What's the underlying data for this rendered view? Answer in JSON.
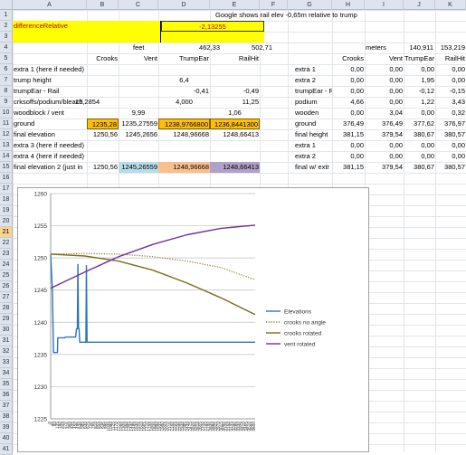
{
  "columns": [
    "A",
    "B",
    "C",
    "D",
    "E",
    "F",
    "G",
    "H",
    "I",
    "J",
    "K"
  ],
  "rows": [
    "1",
    "2",
    "3",
    "4",
    "5",
    "6",
    "7",
    "8",
    "9",
    "10",
    "11",
    "12",
    "13",
    "14",
    "15",
    "16",
    "17",
    "18",
    "19",
    "20",
    "21",
    "22",
    "23",
    "24",
    "25",
    "26",
    "27",
    "28",
    "29",
    "30",
    "31",
    "32",
    "33",
    "34",
    "35",
    "36",
    "37",
    "38",
    "39",
    "40",
    "41"
  ],
  "header_note": "Google shows rail elev -0,65m relative to trump",
  "row2": {
    "label": "differenceRelative",
    "value": "-2,13255"
  },
  "row4": {
    "feet_label": "feet",
    "feet_d": "462,33",
    "feet_e": "502,71",
    "meters_label": "meters",
    "meters_j": "140,911",
    "meters_k": "153,219"
  },
  "left_table": {
    "headers": [
      "Crooks",
      "Vent",
      "TrumpEar",
      "RailHit"
    ],
    "rows": [
      {
        "label": "extra 1 (here if needed)",
        "b": "",
        "c": "",
        "d": "",
        "e": ""
      },
      {
        "label": "trump height",
        "b": "",
        "c": "",
        "d": "6,4",
        "e": ""
      },
      {
        "label": "trumpEar - Rail",
        "b": "",
        "c": "",
        "d": "-0,41",
        "e": "-0,49"
      },
      {
        "label": "crksoffs/podium/bleach",
        "b": "15,2854",
        "c": "",
        "d": "4,000",
        "e": "11,25"
      },
      {
        "label": "woodblock / vent",
        "b": "",
        "c": "9,99",
        "d": "",
        "e": "1,06"
      },
      {
        "label": "ground",
        "b": "1235,28",
        "c": "1235,27559",
        "d": "1238,9766800",
        "e": "1236,8441300"
      },
      {
        "label": "final elevation",
        "b": "1250,56",
        "c": "1245,2656",
        "d": "1248,96668",
        "e": "1248,66413"
      },
      {
        "label": "extra 3  (here if needed)",
        "b": "",
        "c": "",
        "d": "",
        "e": ""
      },
      {
        "label": "extra 4 (here if needed)",
        "b": "",
        "c": "",
        "d": "",
        "e": ""
      },
      {
        "label": "final elevation 2 (just in",
        "b": "1250,56",
        "c": "1245,26559",
        "d": "1248,96668",
        "e": "1248,66413"
      }
    ]
  },
  "right_table": {
    "headers": [
      "Crooks",
      "Vent",
      "TrumpEar",
      "RailHit"
    ],
    "rows": [
      {
        "label": "extra 1",
        "h": "0,00",
        "i": "0,00",
        "j": "0,00",
        "k": "0,00"
      },
      {
        "label": "extra 2",
        "h": "0,00",
        "i": "0,00",
        "j": "1,95",
        "k": "0,00"
      },
      {
        "label": "trumpEar - R",
        "h": "0,00",
        "i": "0,00",
        "j": "-0,12",
        "k": "-0,15"
      },
      {
        "label": "podium",
        "h": "4,66",
        "i": "0,00",
        "j": "1,22",
        "k": "3,43"
      },
      {
        "label": "wooden",
        "h": "0,00",
        "i": "3,04",
        "j": "0,00",
        "k": "0,32"
      },
      {
        "label": "ground",
        "h": "376,49",
        "i": "376,49",
        "j": "377,62",
        "k": "376,97"
      },
      {
        "label": "final height",
        "h": "381,15",
        "i": "379,54",
        "j": "380,67",
        "k": "380,57"
      },
      {
        "label": "extra 1",
        "h": "0,00",
        "i": "0,00",
        "j": "0,00",
        "k": "0,00"
      },
      {
        "label": "extra 2",
        "h": "0,00",
        "i": "0,00",
        "j": "0,00",
        "k": "0,00"
      },
      {
        "label": "final w/ extr",
        "h": "381,15",
        "i": "379,54",
        "j": "380,67",
        "k": "380,57"
      }
    ]
  },
  "colors": {
    "yellow": "#ffff00",
    "ground_highlight": "#ffc000",
    "vent_fill": "#b7dee8",
    "trumpear_fill": "#fabf8f",
    "railhit_fill": "#b1a0c7",
    "elevations": "#2e75b6",
    "crooks_no_angle": "#8b7d2a",
    "crooks_rotated": "#7f6b1a",
    "vent_rotated": "#7030a0"
  },
  "chart_data": {
    "type": "line",
    "title": "",
    "xlabel": "",
    "ylabel": "",
    "ylim": [
      1225,
      1260
    ],
    "yticks": [
      1225,
      1230,
      1235,
      1240,
      1245,
      1250,
      1255,
      1260
    ],
    "x": [
      0,
      45,
      90,
      135,
      180,
      225,
      270,
      315,
      360,
      405,
      450,
      495,
      540,
      585,
      630,
      675,
      720,
      765,
      810,
      855,
      900,
      945,
      990,
      1035,
      1080,
      1125,
      1170,
      1215,
      1260,
      1305,
      1350,
      1395,
      1440,
      1485,
      1530,
      1575,
      1620,
      1665,
      1710,
      1755,
      1800,
      1845,
      1890,
      1935,
      1980,
      2025,
      2070,
      2115,
      2160,
      2205,
      2250,
      2295,
      2340,
      2385,
      2430,
      2475,
      2520,
      2565,
      2610,
      2655,
      2700,
      2745,
      2790,
      2835,
      2880,
      2925,
      2970,
      3015,
      3060,
      3105,
      3150,
      3195,
      3240,
      3285,
      3330,
      3375,
      3420,
      3465,
      3510,
      3555,
      3600
    ],
    "series": [
      {
        "name": "Elevations",
        "style": "solid",
        "color": "#2e75b6",
        "points": [
          [
            0,
            1250.5
          ],
          [
            30,
            1245
          ],
          [
            50,
            1235.3
          ],
          [
            90,
            1235.3
          ],
          [
            120,
            1235.3
          ],
          [
            125,
            1237.6
          ],
          [
            150,
            1237.6
          ],
          [
            250,
            1237.6
          ],
          [
            260,
            1237.7
          ],
          [
            440,
            1237.7
          ],
          [
            455,
            1239
          ],
          [
            470,
            1239
          ],
          [
            480,
            1249
          ],
          [
            490,
            1239
          ],
          [
            500,
            1239
          ],
          [
            512,
            1236.9
          ],
          [
            600,
            1236.9
          ],
          [
            620,
            1236.9
          ],
          [
            630,
            1248.8
          ],
          [
            640,
            1236.9
          ],
          [
            3600,
            1236.9
          ]
        ]
      },
      {
        "name": "crooks no angle",
        "style": "dotted",
        "color": "#8b7d2a",
        "points": [
          [
            0,
            1250.6
          ],
          [
            600,
            1250.7
          ],
          [
            1200,
            1250.6
          ],
          [
            1800,
            1250.2
          ],
          [
            2400,
            1249.5
          ],
          [
            3000,
            1248.5
          ],
          [
            3600,
            1246.6
          ]
        ]
      },
      {
        "name": "crooks rotated",
        "style": "solid",
        "color": "#7f6b1a",
        "points": [
          [
            0,
            1250.6
          ],
          [
            600,
            1250.3
          ],
          [
            1200,
            1249.5
          ],
          [
            1800,
            1248.1
          ],
          [
            2400,
            1246.1
          ],
          [
            3000,
            1243.8
          ],
          [
            3600,
            1241.2
          ]
        ]
      },
      {
        "name": "vent rotated",
        "style": "solid",
        "color": "#7030a0",
        "points": [
          [
            0,
            1245.3
          ],
          [
            600,
            1247.8
          ],
          [
            1200,
            1250.2
          ],
          [
            1800,
            1252.1
          ],
          [
            2400,
            1253.6
          ],
          [
            3000,
            1254.6
          ],
          [
            3600,
            1255.1
          ]
        ]
      }
    ]
  }
}
